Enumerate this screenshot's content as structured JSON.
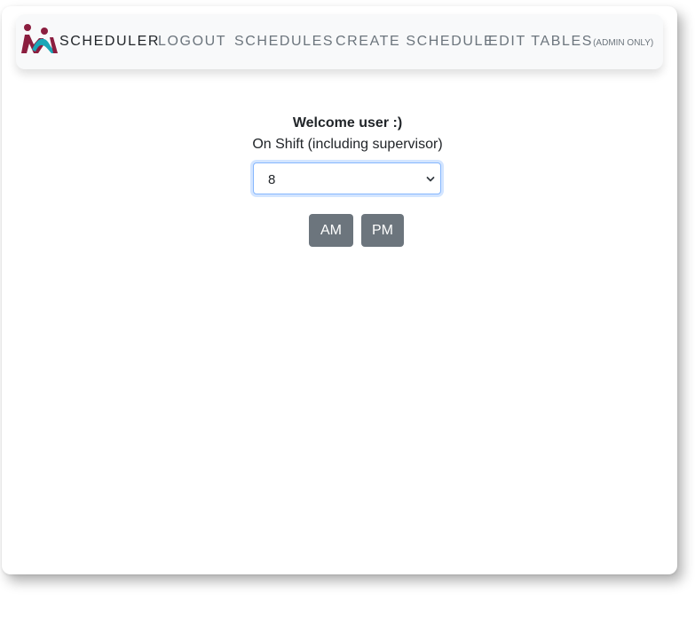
{
  "navbar": {
    "brand": "SCHEDULER",
    "links": {
      "logout": "LOGOUT",
      "schedules": "SCHEDULES",
      "create_schedule": "CREATE SCHEDULE",
      "edit_tables": "EDIT TABLES",
      "edit_tables_note": "(ADMIN ONLY)"
    },
    "logo_icon": "people-logo-icon"
  },
  "main": {
    "welcome": "Welcome user :)",
    "shift_label": "On Shift (including supervisor)",
    "shift_select": {
      "selected": "8"
    },
    "buttons": {
      "am": "AM",
      "pm": "PM"
    }
  },
  "colors": {
    "logo_maroon": "#8b1e3f",
    "logo_teal": "#1aa6b7",
    "button_gray": "#6c757d",
    "focus_blue": "#86b7fe"
  }
}
